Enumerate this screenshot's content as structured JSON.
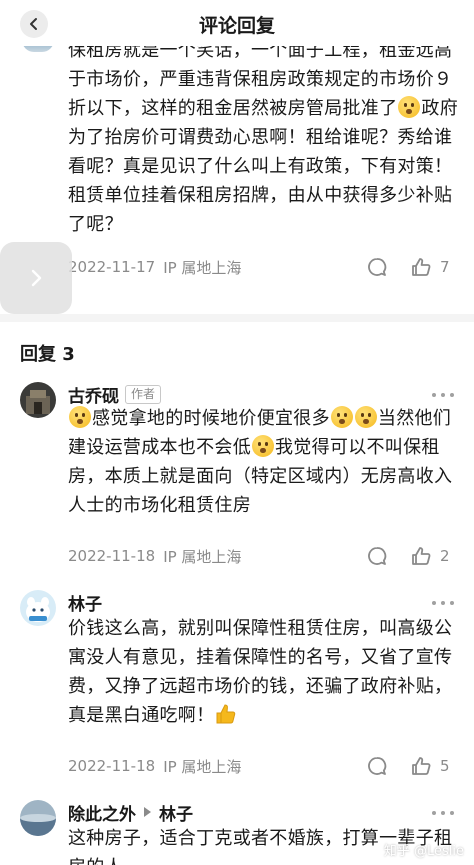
{
  "header": {
    "title": "评论回复",
    "back_icon": "chevron-left-icon"
  },
  "top_comment": {
    "text": "保租房就是一个笑话，一个面子工程，租金远高于市场价，严重违背保租房政策规定的市场价９折以下，这样的租金居然被房管局批准了🫢政府为了抬房价可谓费劲心思啊！租给谁呢？秀给谁看呢？真是见识了什么叫上有政策，下有对策！租赁单位挂着保租房招牌，由从中获得多少补贴了呢？",
    "text_before_emoji": "保租房就是一个笑话，一个面子工程，租金远高于市场价，严重违背保租房政策规定的市场价９折以下，这样的租金居然被房管局批准了",
    "text_after_emoji": "政府为了抬房价可谓费劲心思啊！租给谁呢？秀给谁看呢？真是见识了什么叫上有政策，下有对策！租赁单位挂着保租房招牌，由从中获得多少补贴了呢？",
    "date": "2022-11-17",
    "ip": "IP 属地上海",
    "likes": "7"
  },
  "section_title": "回复 3",
  "replies": [
    {
      "author": "古乔砚",
      "badge": "作者",
      "text_parts": [
        "感觉拿地的时候地价便宜很多",
        "当然他们建设运营成本也不会低",
        "我觉得可以不叫保租房，本质上就是面向（特定区域内）无房高收入人士的市场化租赁住房"
      ],
      "date": "2022-11-18",
      "ip": "IP 属地上海",
      "likes": "2"
    },
    {
      "author": "林子",
      "text": "价钱这么高，就别叫保障性租赁住房，叫高级公寓没人有意见，挂着保障性的名号，又省了宣传费，又挣了远超市场价的钱，还骗了政府补贴，真是黑白通吃啊！",
      "date": "2022-11-18",
      "ip": "IP 属地上海",
      "likes": "5"
    },
    {
      "author": "除此之外",
      "reply_to": "林子",
      "text": "这种房子，适合丁克或者不婚族，打算一辈子租房的人"
    }
  ],
  "watermark": "知乎 @Leslie",
  "colors": {
    "meta": "#8a8a8a",
    "divider": "#f4f4f4",
    "text": "#1a1a1a"
  }
}
